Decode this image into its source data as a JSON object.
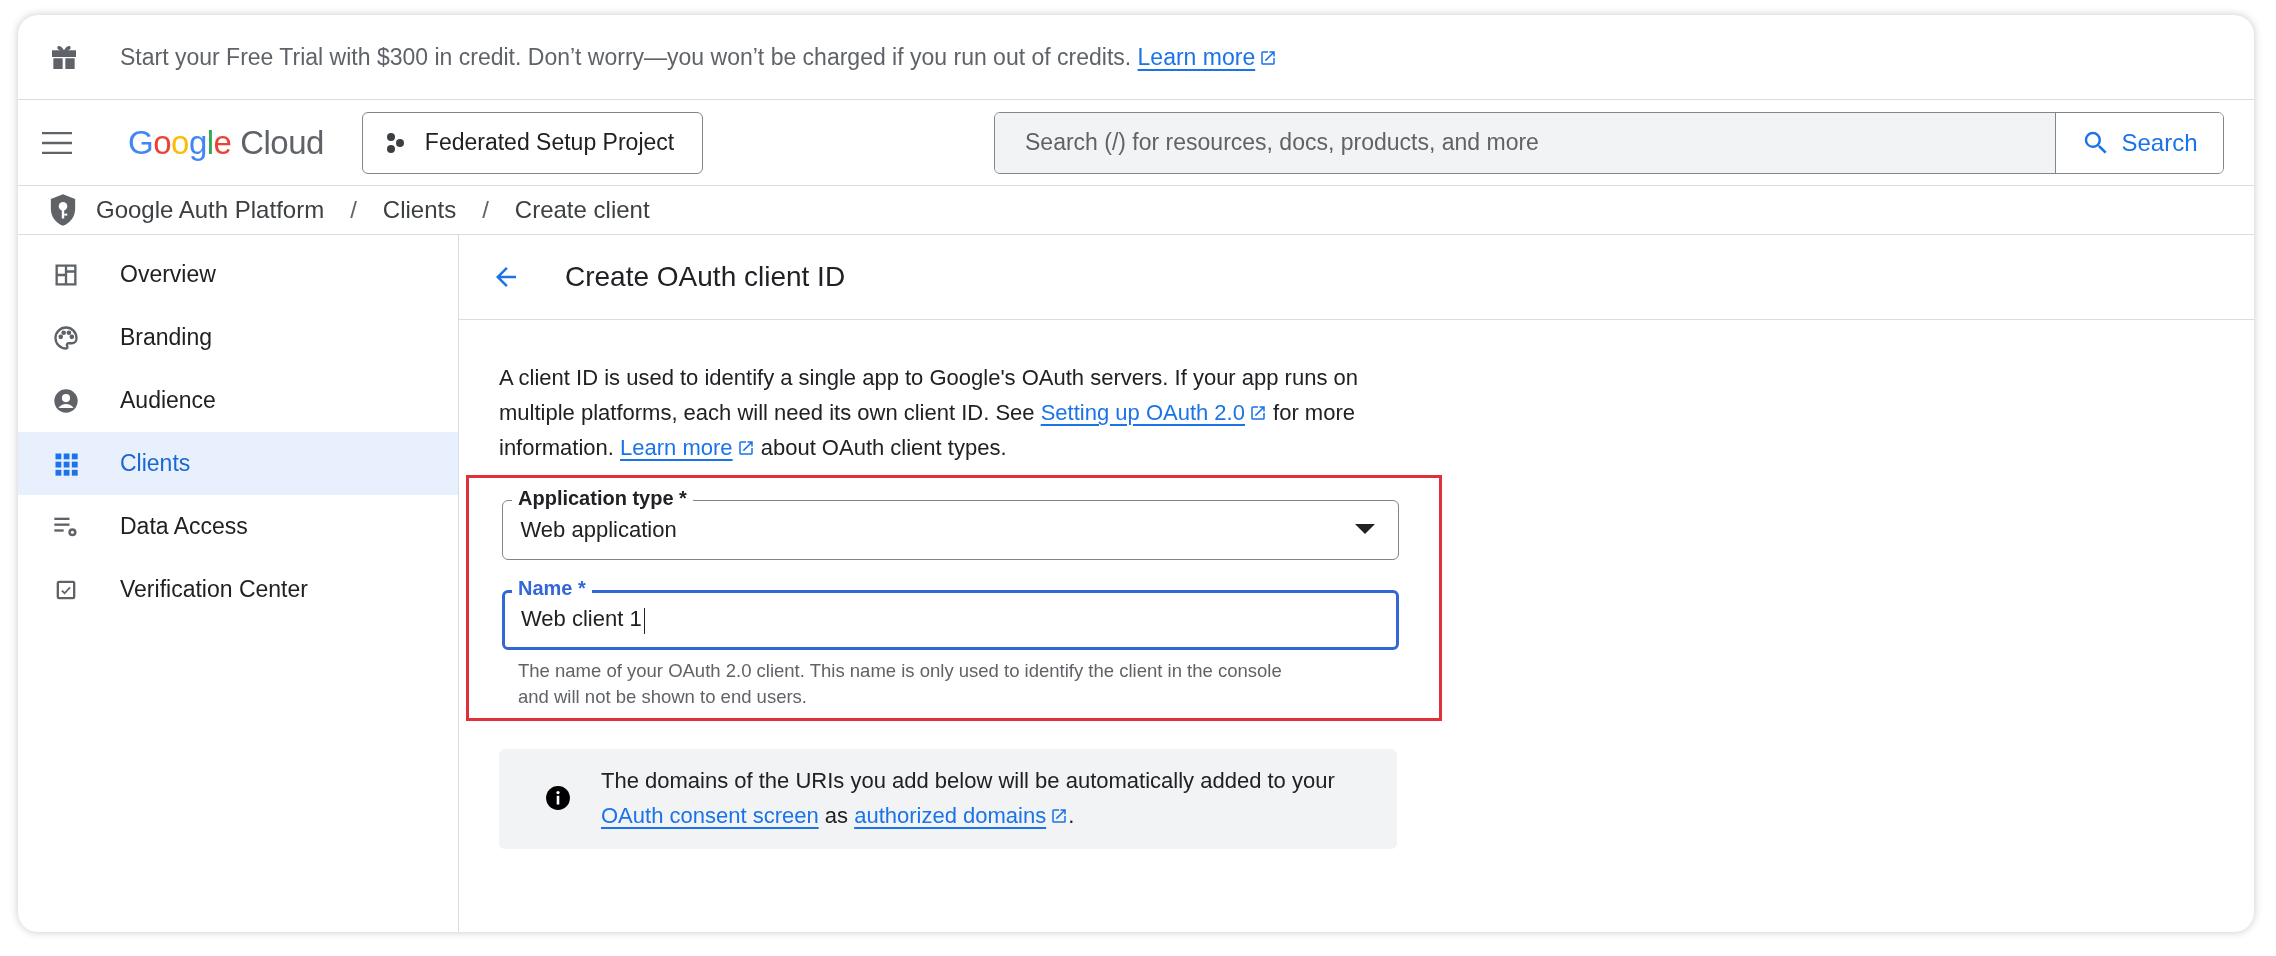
{
  "banner": {
    "text": "Start your Free Trial with $300 in credit. Don’t worry—you won’t be charged if you run out of credits.",
    "link": "Learn more"
  },
  "header": {
    "logo": {
      "brand": "Google",
      "product": "Cloud"
    },
    "project": "Federated Setup Project",
    "search": {
      "placeholder": "Search (/) for resources, docs, products, and more",
      "button": "Search"
    }
  },
  "breadcrumb": {
    "separator": "/",
    "items": [
      "Google Auth Platform",
      "Clients",
      "Create client"
    ]
  },
  "sidebar": {
    "items": [
      {
        "label": "Overview",
        "selected": false
      },
      {
        "label": "Branding",
        "selected": false
      },
      {
        "label": "Audience",
        "selected": false
      },
      {
        "label": "Clients",
        "selected": true
      },
      {
        "label": "Data Access",
        "selected": false
      },
      {
        "label": "Verification Center",
        "selected": false
      }
    ]
  },
  "page": {
    "title": "Create OAuth client ID",
    "intro": [
      {
        "kind": "text",
        "text": "A client ID is used to identify a single app to Google's OAuth servers. If your app runs on multiple platforms, each will need its own client ID. See "
      },
      {
        "kind": "link",
        "text": "Setting up OAuth 2.0",
        "external": true
      },
      {
        "kind": "text",
        "text": " for more information. "
      },
      {
        "kind": "link",
        "text": "Learn more",
        "external": true
      },
      {
        "kind": "text",
        "text": " about OAuth client types."
      }
    ],
    "form": {
      "highlighted": true,
      "fields": [
        {
          "kind": "select",
          "label": "Application type *",
          "value": "Web application",
          "focused": false
        },
        {
          "kind": "text",
          "label": "Name *",
          "value": "Web client 1",
          "focused": true,
          "hint": "The name of your OAuth 2.0 client. This name is only used to identify the client in the console and will not be shown to end users."
        }
      ]
    },
    "notice": [
      {
        "kind": "text",
        "text": "The domains of the URIs you add below will be automatically added to your "
      },
      {
        "kind": "link",
        "text": "OAuth consent screen",
        "external": false
      },
      {
        "kind": "text",
        "text": " as "
      },
      {
        "kind": "link",
        "text": "authorized domains",
        "external": true
      },
      {
        "kind": "text",
        "text": "."
      }
    ]
  }
}
